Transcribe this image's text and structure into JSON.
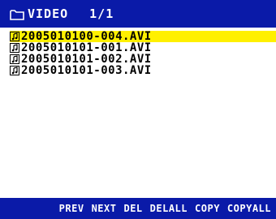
{
  "header": {
    "title": "VIDEO",
    "page": "1/1",
    "icon": "folder-icon"
  },
  "files": [
    {
      "name": "2005010100-004.AVI",
      "selected": true,
      "icon": "music-note-icon"
    },
    {
      "name": "2005010101-001.AVI",
      "selected": false,
      "icon": "music-note-icon"
    },
    {
      "name": "2005010101-002.AVI",
      "selected": false,
      "icon": "music-note-icon"
    },
    {
      "name": "2005010101-003.AVI",
      "selected": false,
      "icon": "music-note-icon"
    }
  ],
  "toolbar": {
    "prev": "PREV",
    "next": "NEXT",
    "del": "DEL",
    "delall": "DELALL",
    "copy": "COPY",
    "copyall": "COPYALL"
  },
  "colors": {
    "bar_blue": "#0a1aa8",
    "highlight": "#fff000",
    "text": "#000000",
    "bar_text": "#ffffff"
  }
}
